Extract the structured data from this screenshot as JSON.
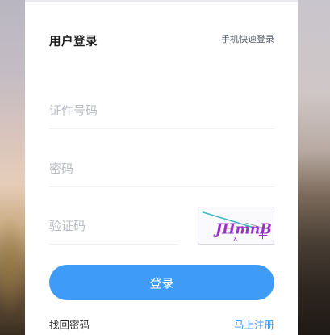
{
  "login": {
    "title": "用户登录",
    "quick_login_link": "手机快速登录",
    "id_number_placeholder": "证件号码",
    "password_placeholder": "密码",
    "captcha_placeholder": "验证码",
    "captcha_text": "JHmnB",
    "submit_label": "登录",
    "forgot_password_link": "找回密码",
    "register_link": "马上注册"
  },
  "colors": {
    "accent": "#3e9bf7",
    "link": "#3390f0",
    "captcha_text": "#9b30c8"
  }
}
